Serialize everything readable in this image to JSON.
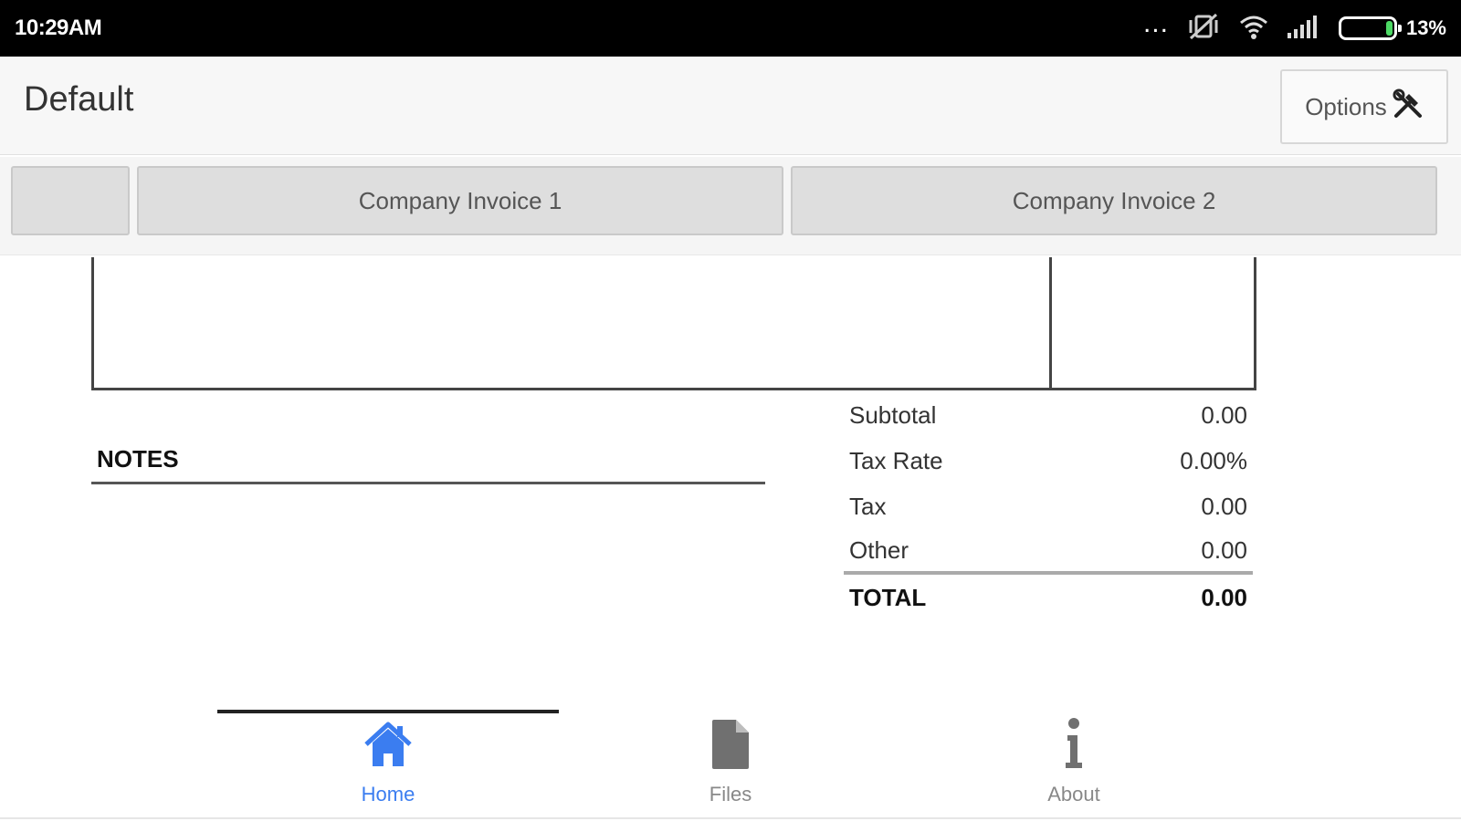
{
  "status_bar": {
    "time": "10:29AM",
    "overflow_dots": "...",
    "battery_percent": "13%",
    "battery_level": 0.13,
    "battery_fill_color": "#4cd964"
  },
  "app_bar": {
    "title": "Default",
    "options_label": "Options",
    "options_icon": "tools-icon"
  },
  "tabs": [
    {
      "label": ""
    },
    {
      "label": "Company Invoice 1"
    },
    {
      "label": "Company Invoice 2"
    }
  ],
  "notes": {
    "label": "NOTES"
  },
  "totals": {
    "subtotal": {
      "label": "Subtotal",
      "value": "0.00"
    },
    "tax_rate": {
      "label": "Tax Rate",
      "value": "0.00%"
    },
    "tax": {
      "label": "Tax",
      "value": "0.00"
    },
    "other": {
      "label": "Other",
      "value": "0.00"
    },
    "total": {
      "label": "TOTAL",
      "value": "0.00"
    }
  },
  "bottom_nav": {
    "items": [
      {
        "label": "Home",
        "icon": "home-icon",
        "active": true
      },
      {
        "label": "Files",
        "icon": "file-icon",
        "active": false
      },
      {
        "label": "About",
        "icon": "info-icon",
        "active": false
      }
    ],
    "active_color": "#3b7df0",
    "inactive_color": "#888888"
  }
}
